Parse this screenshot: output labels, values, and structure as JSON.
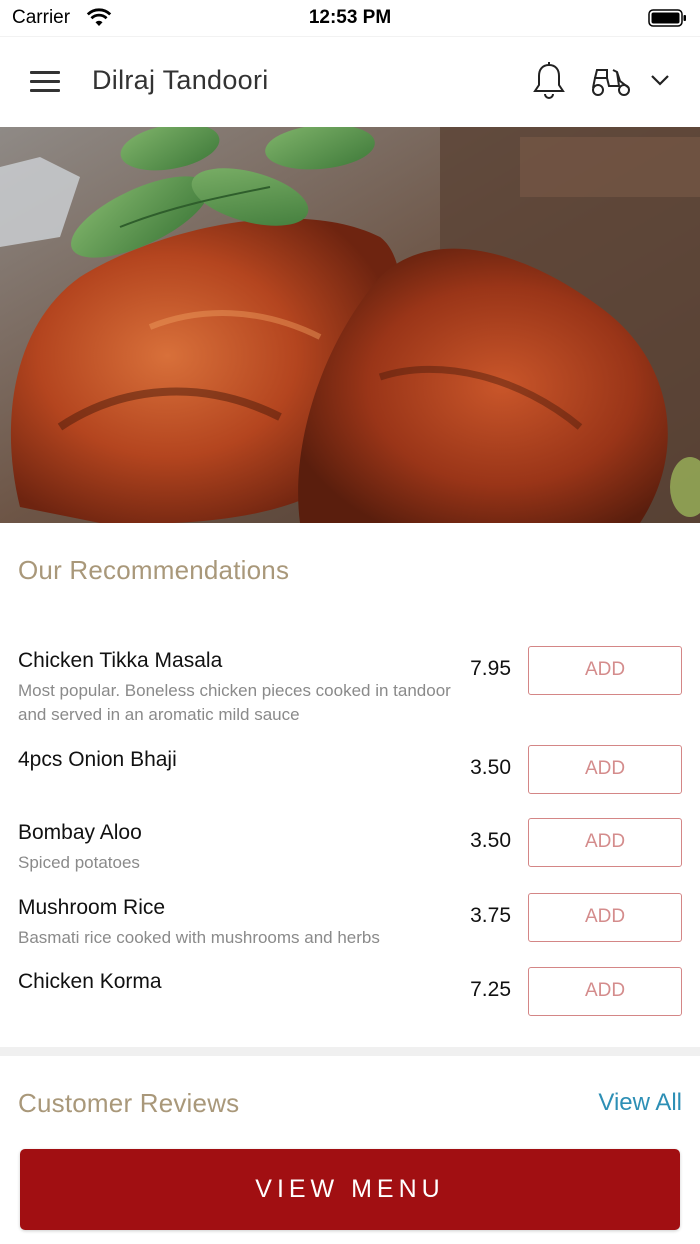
{
  "status_bar": {
    "carrier": "Carrier",
    "time": "12:53 PM"
  },
  "header": {
    "title": "Dilraj Tandoori"
  },
  "icons": {
    "menu": "hamburger-icon",
    "notifications": "bell-icon",
    "delivery": "scooter-icon",
    "dropdown": "chevron-down-icon"
  },
  "recommendations": {
    "title": "Our Recommendations",
    "items": [
      {
        "name": "Chicken Tikka Masala",
        "description": "Most popular. Boneless chicken pieces cooked in tandoor and served in an aromatic mild sauce",
        "price": "7.95",
        "button": "ADD"
      },
      {
        "name": "4pcs Onion Bhaji",
        "description": "",
        "price": "3.50",
        "button": "ADD"
      },
      {
        "name": "Bombay Aloo",
        "description": "Spiced potatoes",
        "price": "3.50",
        "button": "ADD"
      },
      {
        "name": "Mushroom Rice",
        "description": "Basmati rice cooked with mushrooms and herbs",
        "price": "3.75",
        "button": "ADD"
      },
      {
        "name": "Chicken Korma",
        "description": "",
        "price": "7.25",
        "button": "ADD"
      }
    ]
  },
  "reviews": {
    "title": "Customer Reviews",
    "view_all": "View All"
  },
  "cta": {
    "label": "VIEW MENU"
  },
  "colors": {
    "accent": "#a10f12",
    "section_title": "#a9987a",
    "add_border": "#d48686",
    "link": "#2d8fb5"
  }
}
